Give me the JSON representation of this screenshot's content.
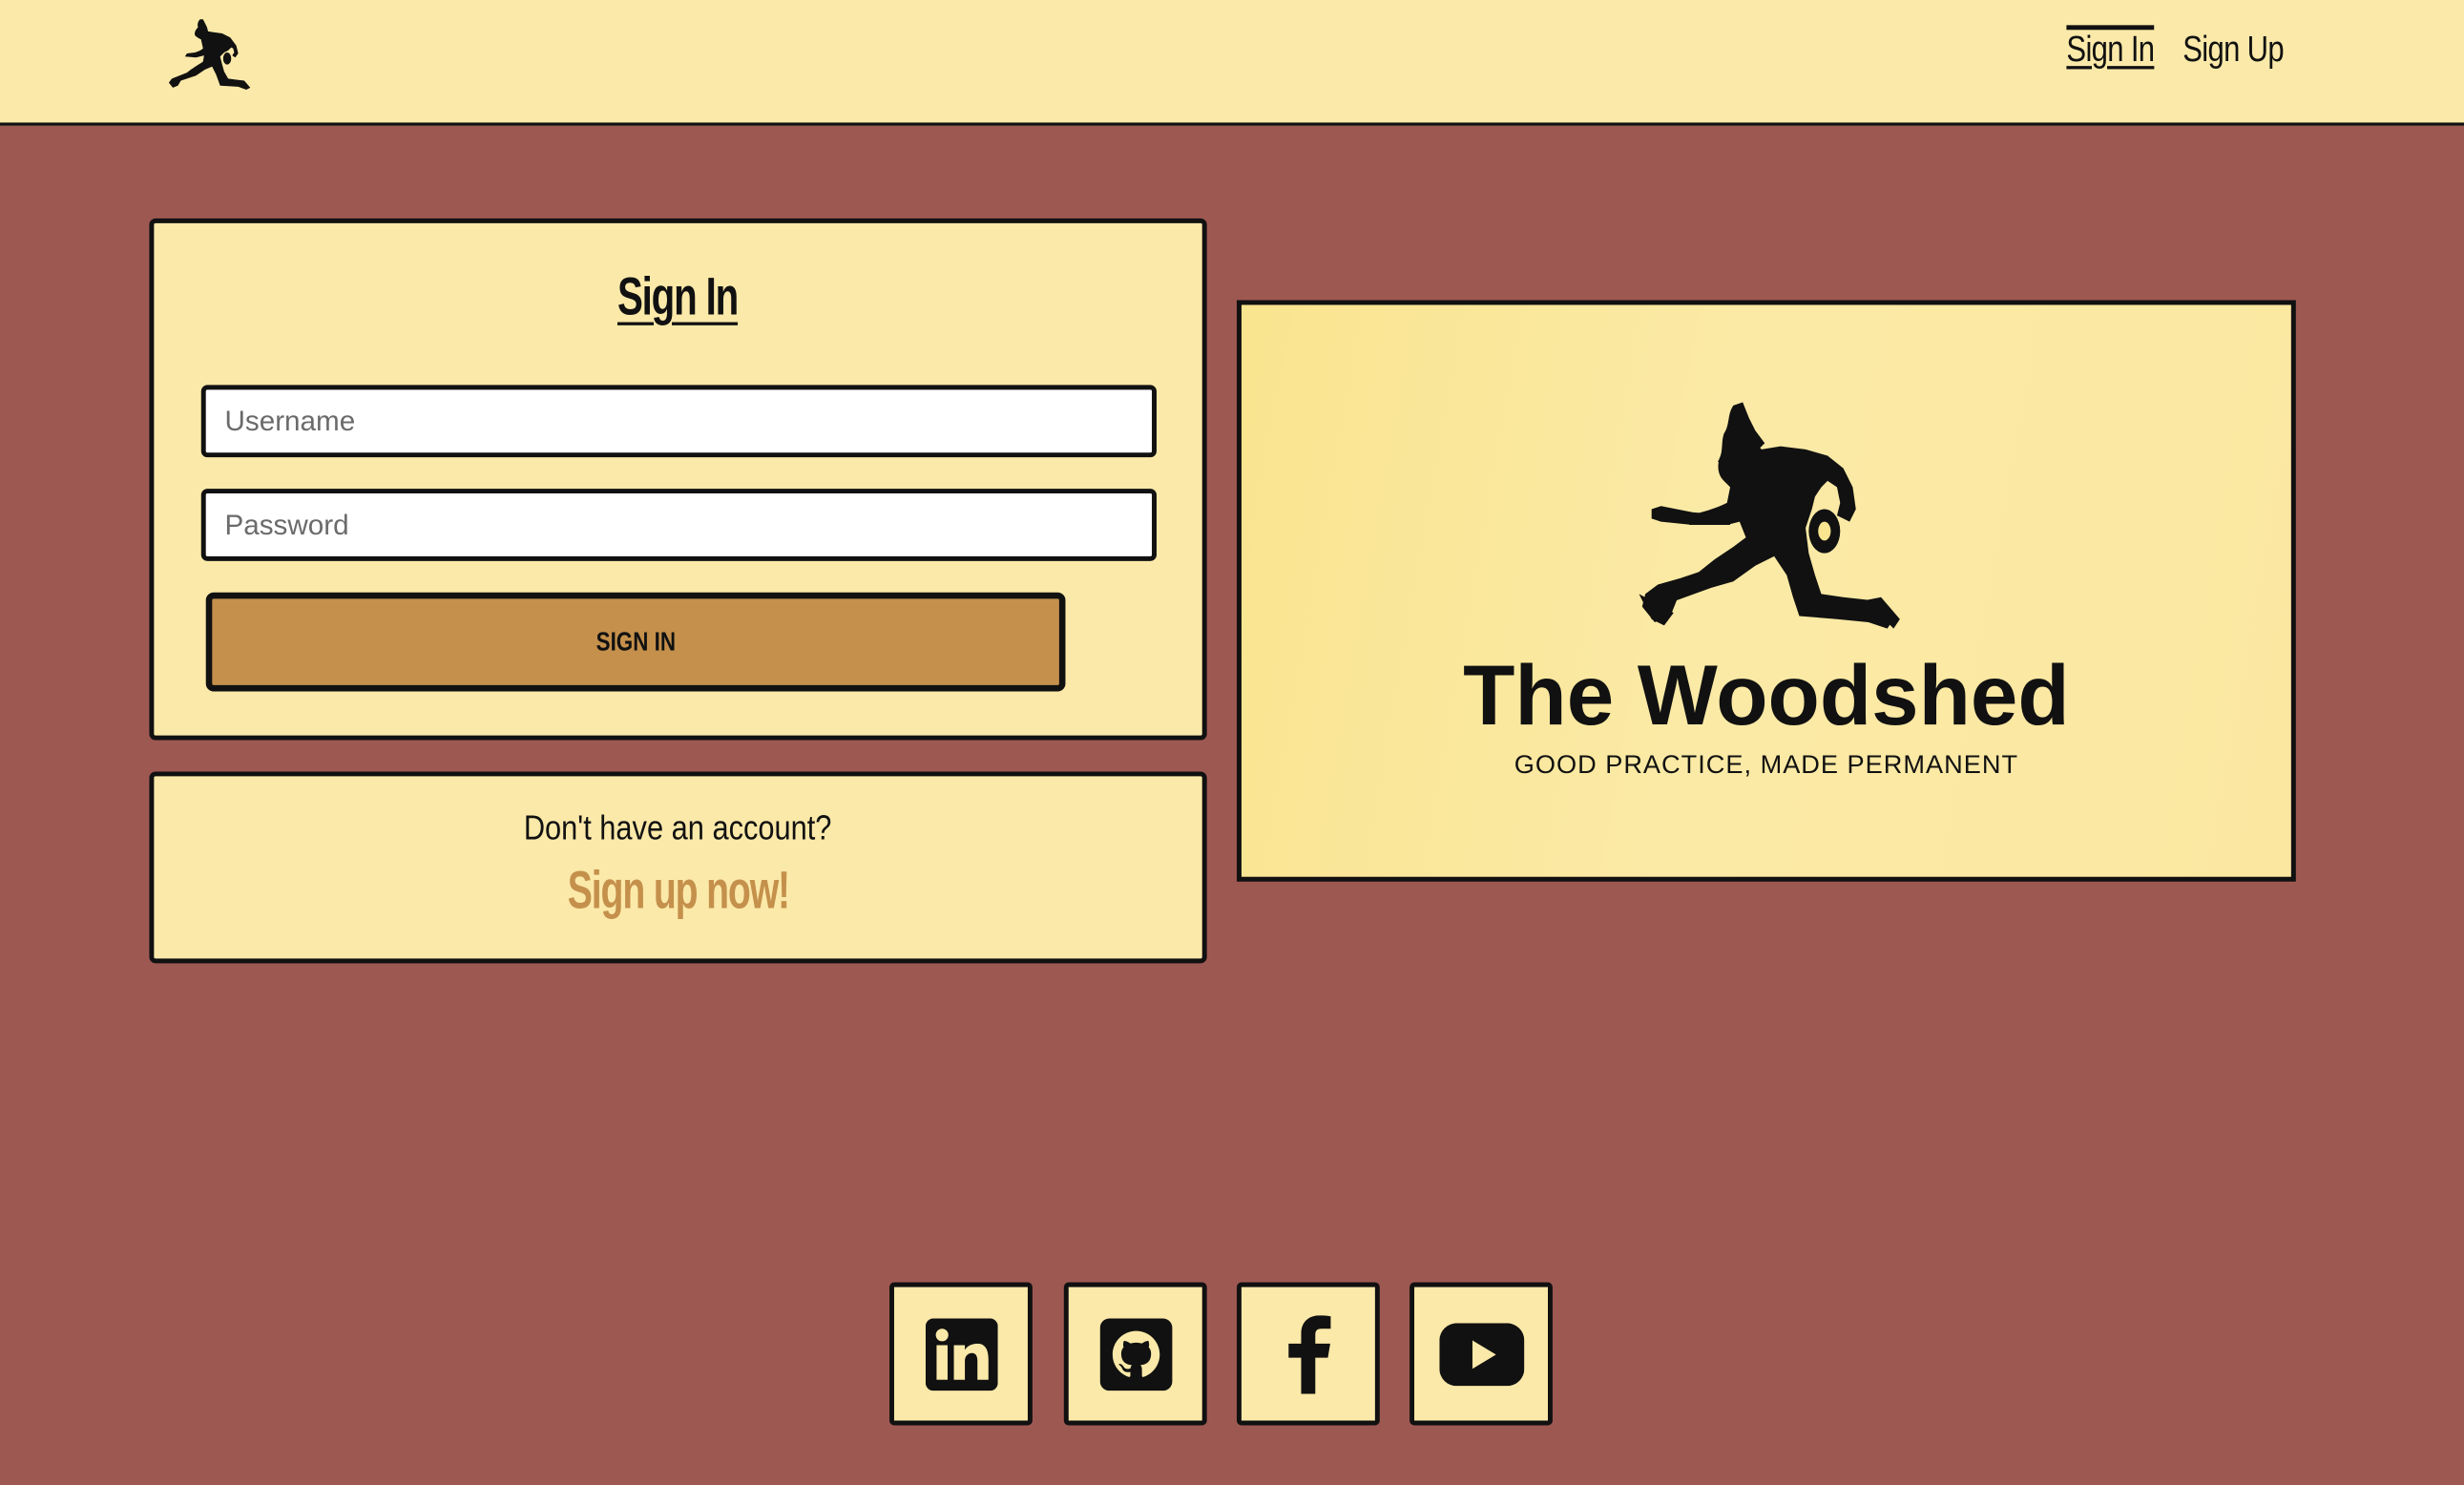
{
  "nav": {
    "logo_icon": "jumping-guitarist-icon",
    "links": [
      {
        "label": "Sign In",
        "active": true
      },
      {
        "label": "Sign Up",
        "active": false
      }
    ]
  },
  "signin": {
    "title": "Sign In",
    "username_placeholder": "Username",
    "password_placeholder": "Password",
    "button_label": "SIGN IN"
  },
  "signup_prompt": {
    "question": "Don't have an account?",
    "link_label": "Sign up now!"
  },
  "brand": {
    "icon": "jumping-guitarist-icon",
    "title": "The Woodshed",
    "tagline": "GOOD PRACTICE, MADE PERMANENT"
  },
  "social": [
    {
      "icon": "linkedin-icon"
    },
    {
      "icon": "github-icon"
    },
    {
      "icon": "facebook-icon"
    },
    {
      "icon": "youtube-icon"
    }
  ],
  "colors": {
    "background": "#9e5852",
    "panel": "#fbe9a9",
    "accent": "#c4904b",
    "ink": "#111111"
  }
}
